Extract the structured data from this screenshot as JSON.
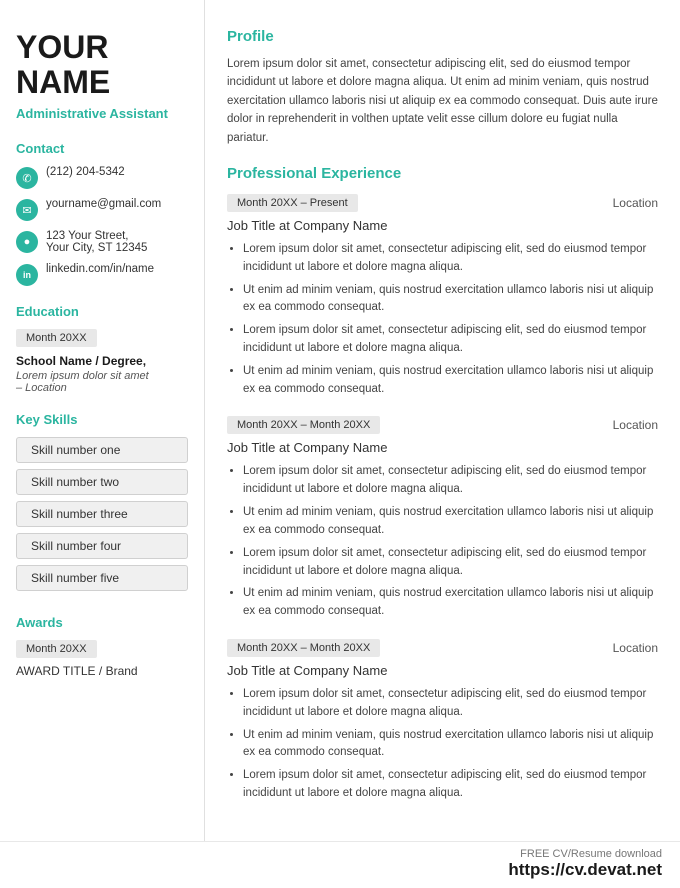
{
  "sidebar": {
    "first_name": "YOUR",
    "last_name": "NAME",
    "job_title": "Administrative Assistant",
    "contact_section": "Contact",
    "contact": {
      "phone": "(212) 204-5342",
      "email": "yourname@gmail.com",
      "address_line1": "123 Your Street,",
      "address_line2": "Your City, ST 12345",
      "linkedin": "linkedin.com/in/name"
    },
    "education_section": "Education",
    "education": {
      "date": "Month 20XX",
      "school": "School Name / Degree,",
      "desc": "Lorem ipsum dolor sit amet",
      "location": "– Location"
    },
    "skills_section": "Key Skills",
    "skills": [
      "Skill number one",
      "Skill number two",
      "Skill number three",
      "Skill number four",
      "Skill number five"
    ],
    "awards_section": "Awards",
    "awards": {
      "date": "Month 20XX",
      "title": "AWARD TITLE / Brand"
    }
  },
  "right": {
    "profile_heading": "Profile",
    "profile_text": "Lorem ipsum dolor sit amet, consectetur adipiscing elit, sed do eiusmod tempor incididunt ut labore et dolore magna aliqua. Ut enim ad minim veniam, quis nostrud exercitation ullamco laboris nisi ut aliquip ex ea commodo consequat. Duis aute irure dolor in reprehenderit in volthen uptate velit esse cillum dolore eu fugiat nulla pariatur.",
    "experience_heading": "Professional Experience",
    "jobs": [
      {
        "date": "Month 20XX – Present",
        "location": "Location",
        "title": "Job Title",
        "company": "at Company Name",
        "bullets": [
          "Lorem ipsum dolor sit amet, consectetur adipiscing elit, sed do eiusmod tempor incididunt ut labore et dolore magna aliqua.",
          "Ut enim ad minim veniam, quis nostrud exercitation ullamco laboris nisi ut aliquip ex ea commodo consequat.",
          "Lorem ipsum dolor sit amet, consectetur adipiscing elit, sed do eiusmod tempor incididunt ut labore et dolore magna aliqua.",
          "Ut enim ad minim veniam, quis nostrud exercitation ullamco laboris nisi ut aliquip ex ea commodo consequat."
        ]
      },
      {
        "date": "Month 20XX – Month 20XX",
        "location": "Location",
        "title": "Job Title",
        "company": "at Company Name",
        "bullets": [
          "Lorem ipsum dolor sit amet, consectetur adipiscing elit, sed do eiusmod tempor incididunt ut labore et dolore magna aliqua.",
          "Ut enim ad minim veniam, quis nostrud exercitation ullamco laboris nisi ut aliquip ex ea commodo consequat.",
          "Lorem ipsum dolor sit amet, consectetur adipiscing elit, sed do eiusmod tempor incididunt ut labore et dolore magna aliqua.",
          "Ut enim ad minim veniam, quis nostrud exercitation ullamco laboris nisi ut aliquip ex ea commodo consequat."
        ]
      },
      {
        "date": "Month 20XX – Month 20XX",
        "location": "Location",
        "title": "Job Title",
        "company": "at Company Name",
        "bullets": [
          "Lorem ipsum dolor sit amet, consectetur adipiscing elit, sed do eiusmod tempor incididunt ut labore et dolore magna aliqua.",
          "Ut enim ad minim veniam, quis nostrud exercitation ullamco laboris nisi ut aliquip ex ea commodo consequat.",
          "Lorem ipsum dolor sit amet, consectetur adipiscing elit, sed do eiusmod tempor incididunt ut labore et dolore magna aliqua."
        ]
      }
    ]
  },
  "footer": {
    "small_text": "FREE CV/Resume download",
    "url": "https://cv.devat.net"
  }
}
